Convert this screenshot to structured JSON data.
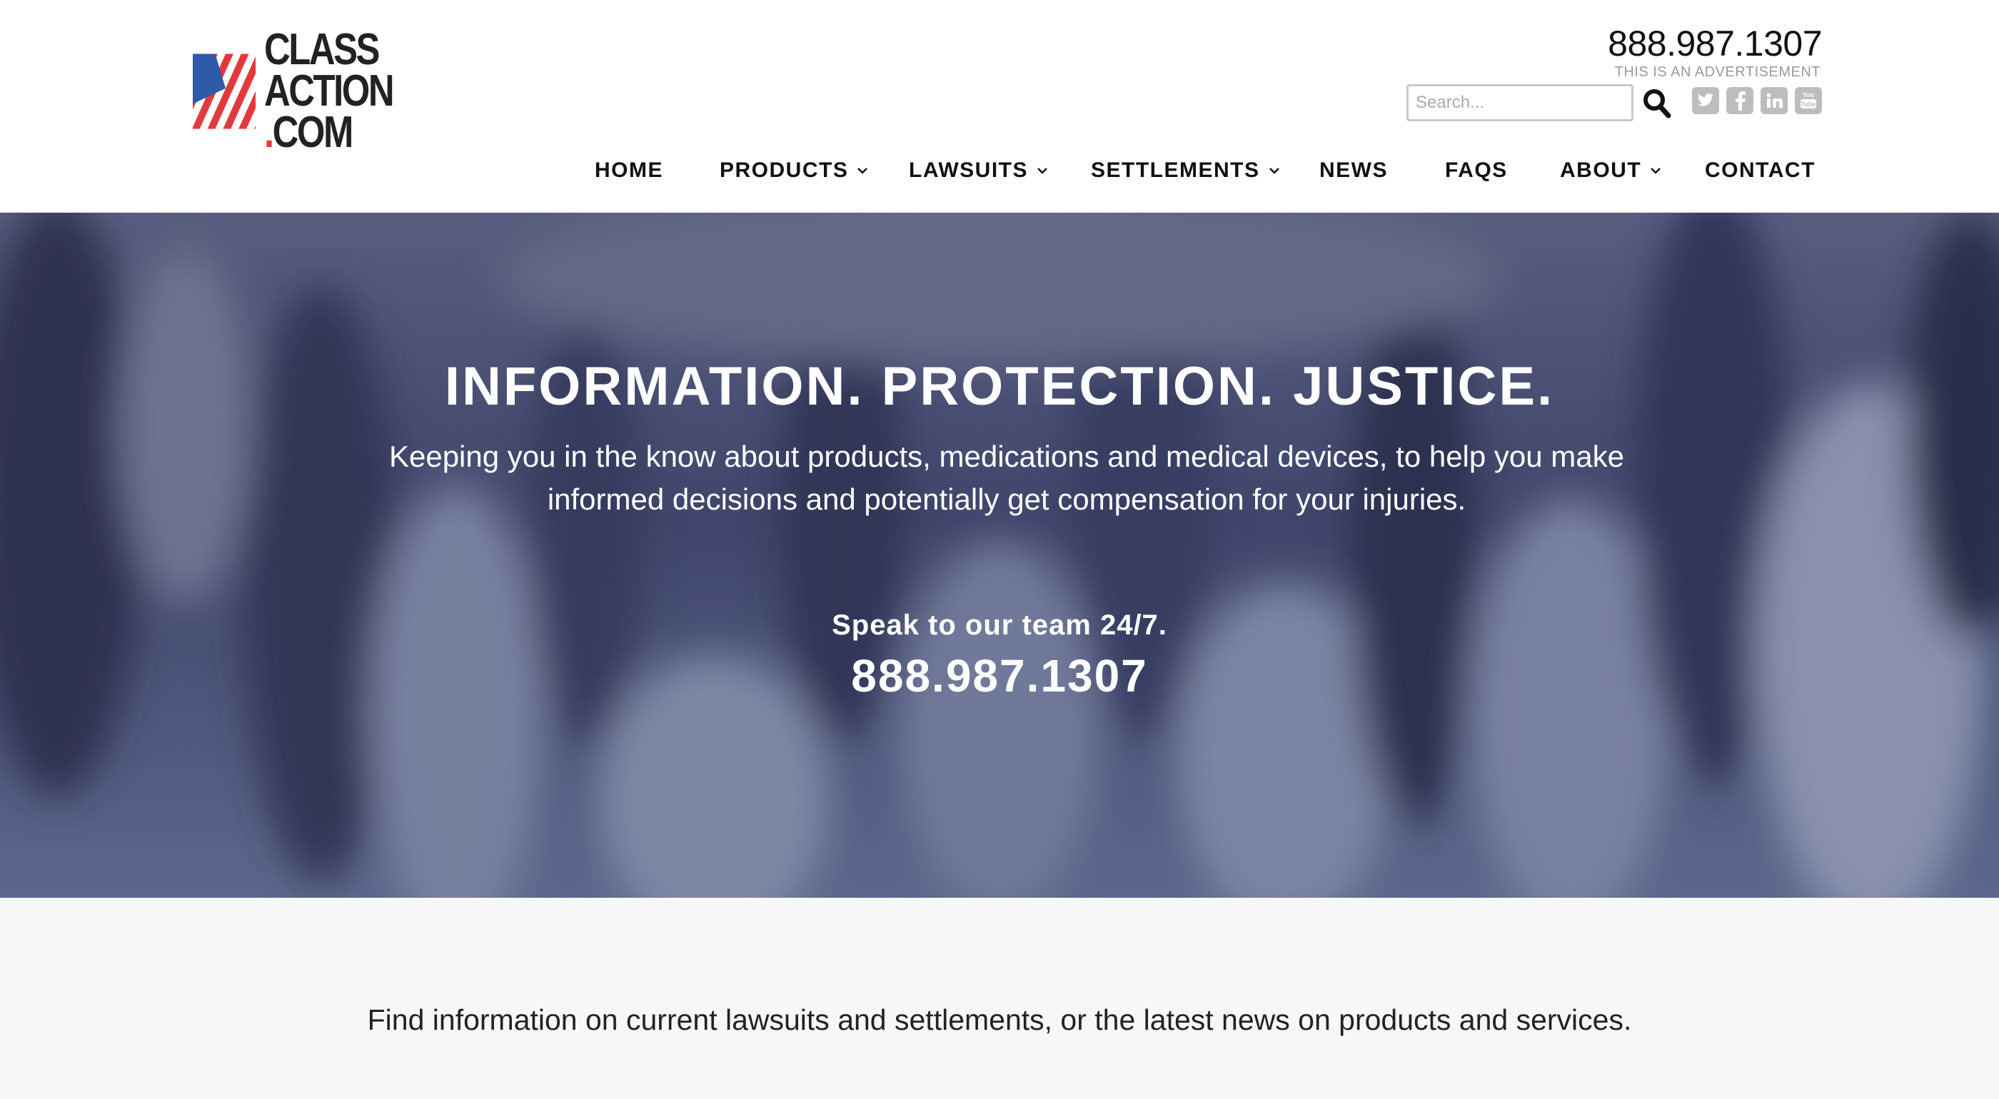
{
  "header": {
    "logo": {
      "line1": "CLASS",
      "line2": "ACTION",
      "line3": "COM"
    },
    "phone": "888.987.1307",
    "ad_note": "THIS IS AN ADVERTISEMENT",
    "search": {
      "placeholder": "Search..."
    },
    "icons": {
      "search": "search-icon",
      "twitter": "twitter-icon",
      "facebook": "facebook-icon",
      "linkedin": "linkedin-icon",
      "youtube": "youtube-icon"
    }
  },
  "nav": {
    "items": [
      {
        "label": "HOME",
        "dropdown": false
      },
      {
        "label": "PRODUCTS",
        "dropdown": true
      },
      {
        "label": "LAWSUITS",
        "dropdown": true
      },
      {
        "label": "SETTLEMENTS",
        "dropdown": true
      },
      {
        "label": "NEWS",
        "dropdown": false
      },
      {
        "label": "FAQS",
        "dropdown": false
      },
      {
        "label": "ABOUT",
        "dropdown": true
      },
      {
        "label": "CONTACT",
        "dropdown": false
      }
    ]
  },
  "hero": {
    "title": "INFORMATION. PROTECTION. JUSTICE.",
    "subtitle": "Keeping you in the know about products, medications and medical devices, to help you make informed decisions and potentially get compensation for your injuries.",
    "speak": "Speak to our team 24/7.",
    "phone": "888.987.1307"
  },
  "intro": {
    "text": "Find information on current lawsuits and settlements, or the latest news on products and services."
  },
  "colors": {
    "logo_blue": "#2e5aa8",
    "logo_red": "#e23a3a",
    "hero_overlay": "#4d5478",
    "intro_bg": "#f7f7f7",
    "social_gray": "#bdbdbd"
  }
}
